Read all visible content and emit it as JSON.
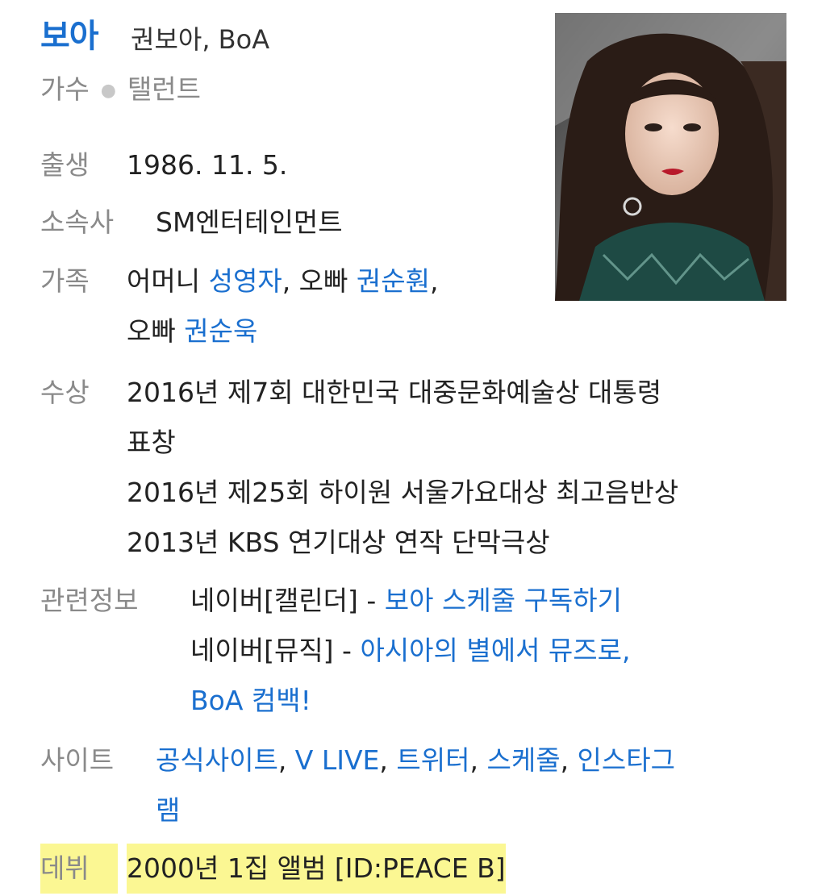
{
  "header": {
    "name": "보아",
    "alias": "권보아, BoA",
    "jobs": [
      "가수",
      "탤런트"
    ]
  },
  "info": {
    "birth": {
      "label": "출생",
      "value": "1986. 11. 5."
    },
    "agency": {
      "label": "소속사",
      "value": "SM엔터테인먼트"
    },
    "family": {
      "label": "가족",
      "rel1": "어머니",
      "name1": "성영자",
      "rel2": "오빠",
      "name2": "권순훤",
      "rel3": "오빠",
      "name3": "권순욱"
    },
    "awards": {
      "label": "수상",
      "items": [
        "2016년 제7회 대한민국 대중문화예술상 대통령",
        "표창",
        "2016년 제25회 하이원 서울가요대상 최고음반상",
        "2013년 KBS 연기대상 연작 단막극상"
      ]
    },
    "related": {
      "label": "관련정보",
      "item1_prefix": "네이버[캘린더] - ",
      "item1_link": "보아 스케줄 구독하기",
      "item2_prefix": "네이버[뮤직] - ",
      "item2_link_line1": "아시아의 별에서 뮤즈로,",
      "item2_link_line2": "BoA 컴백!"
    },
    "sites": {
      "label": "사이트",
      "links": [
        "공식사이트",
        "V LIVE",
        "트위터",
        "스케줄",
        "인스타그",
        "램"
      ]
    },
    "debut": {
      "label": "데뷔",
      "value": "2000년 1집 앨범 [ID:PEACE B]"
    }
  },
  "colors": {
    "link": "#1a6fcf",
    "label": "#8a8a8a",
    "highlight": "#fbf793"
  }
}
